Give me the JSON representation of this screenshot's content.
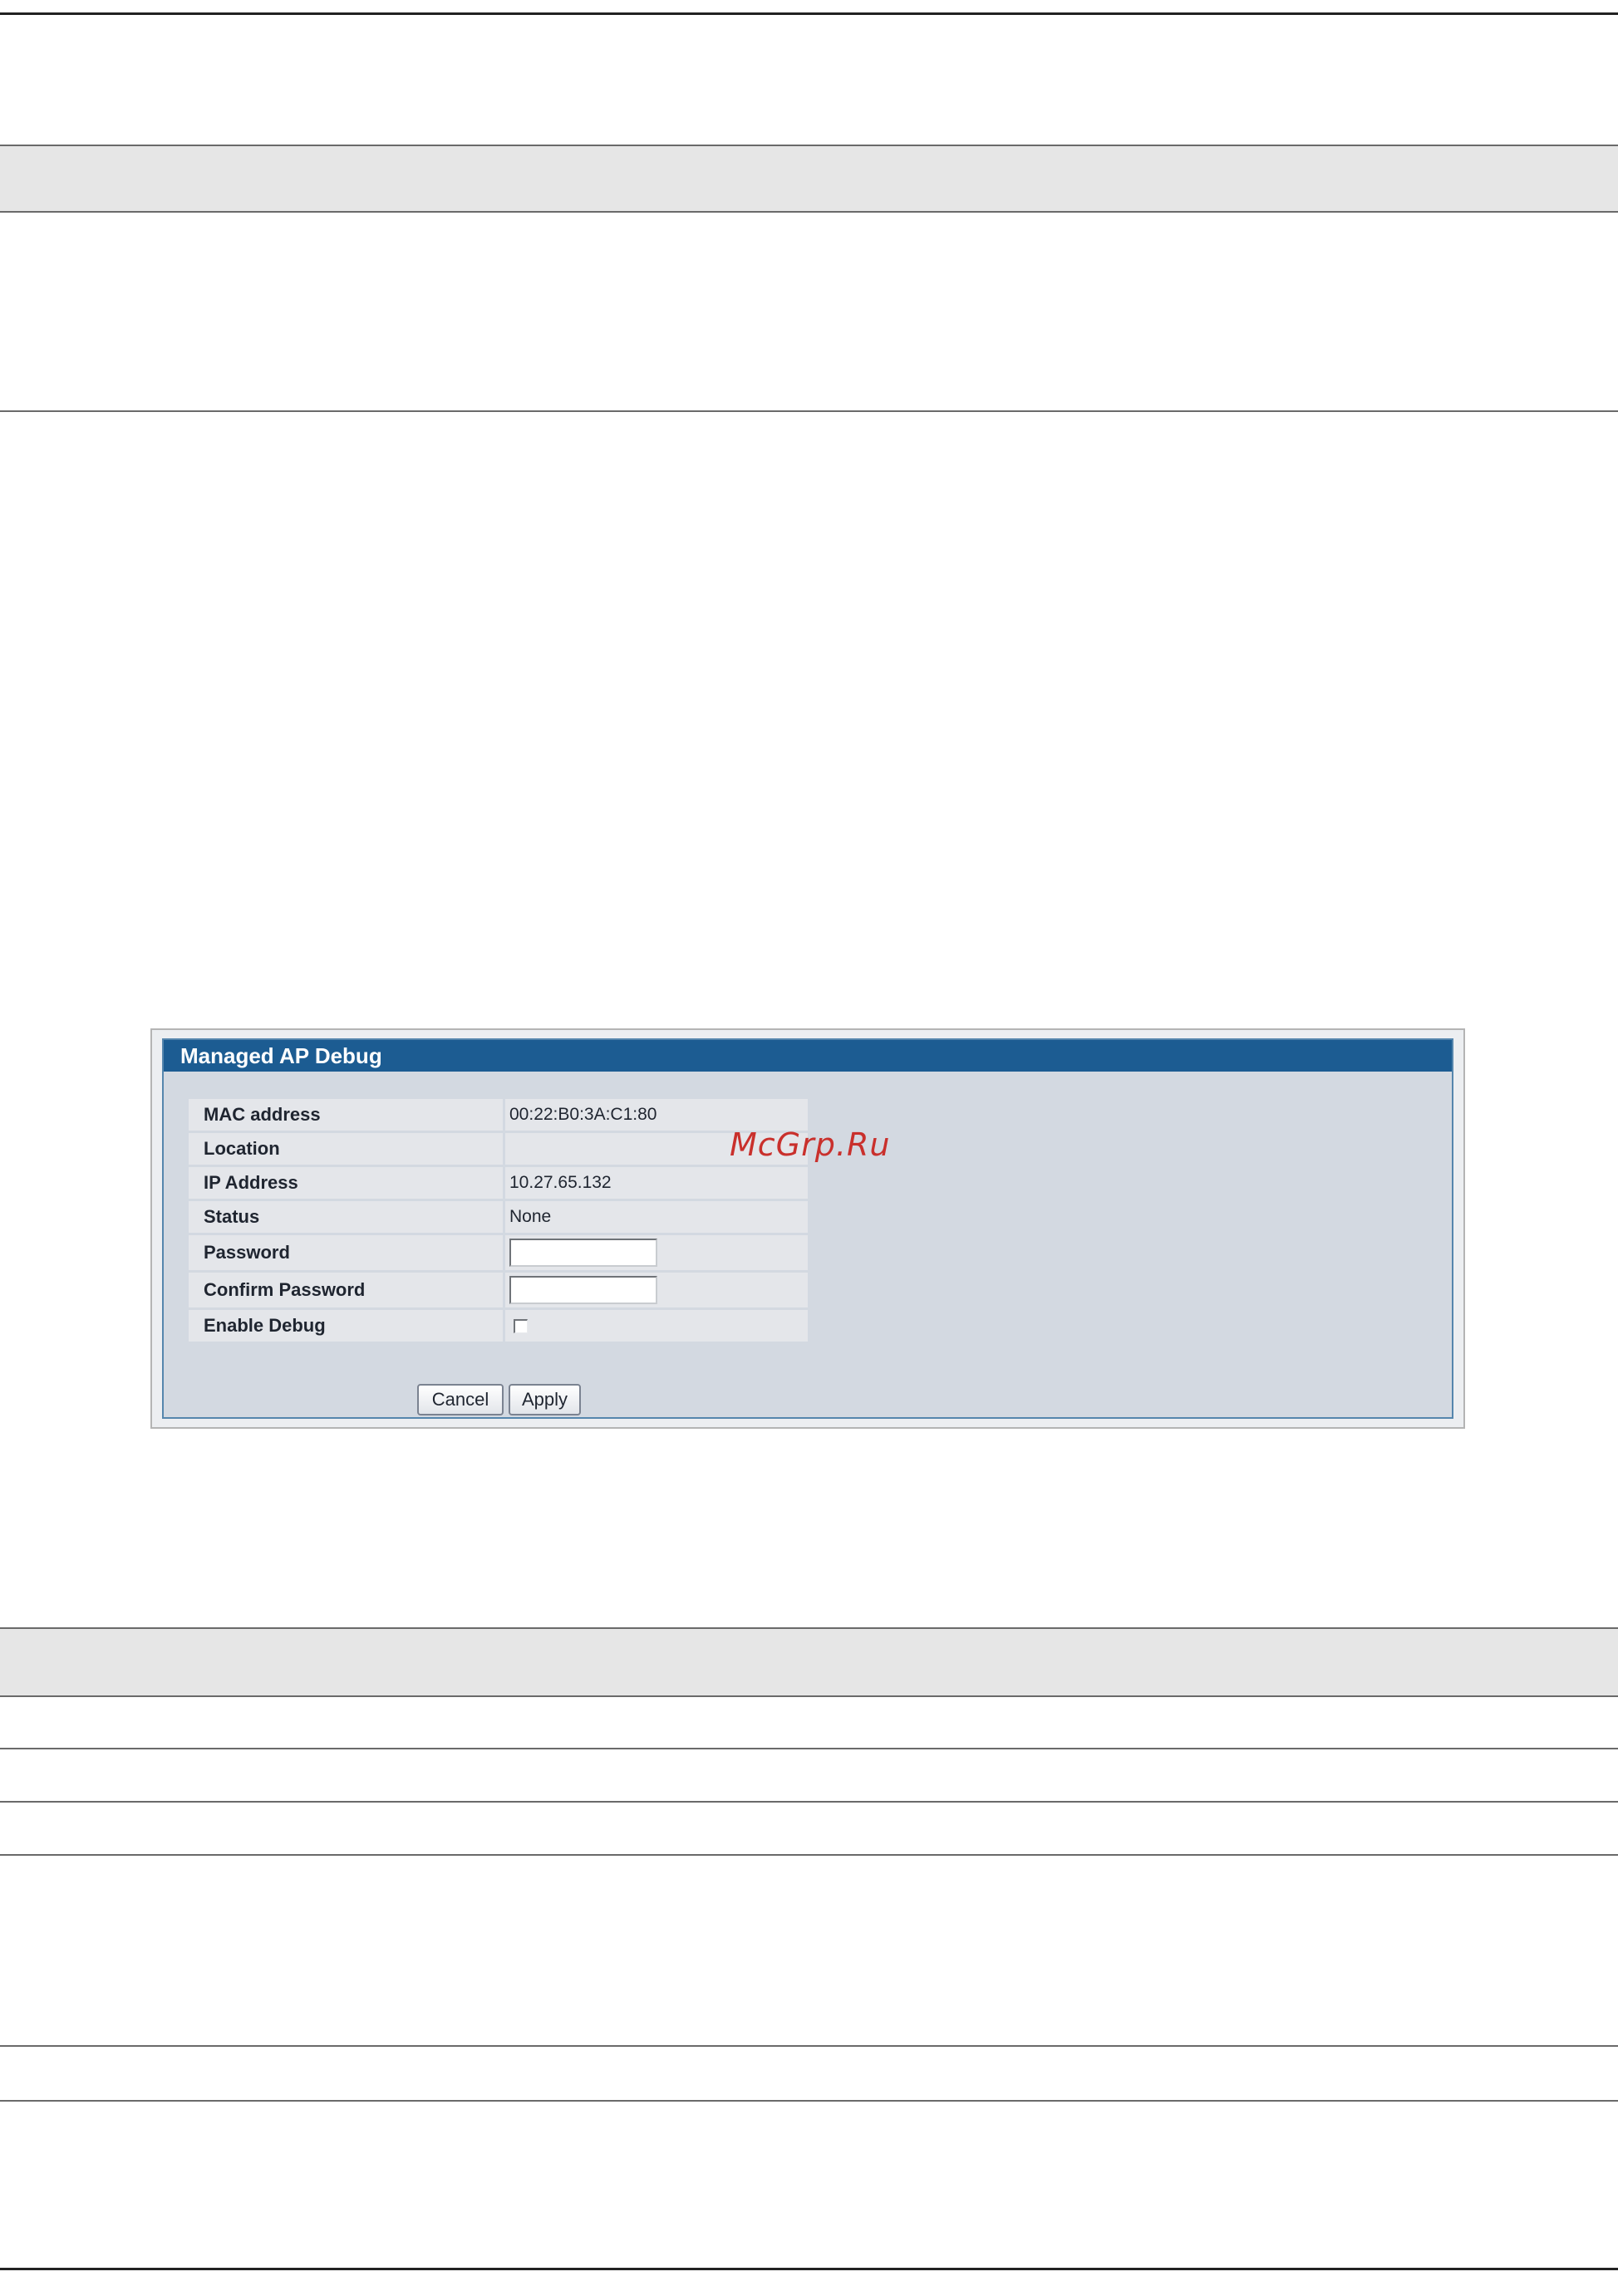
{
  "panel": {
    "title": "Managed AP Debug",
    "fields": {
      "mac_label": "MAC address",
      "mac_value": "00:22:B0:3A:C1:80",
      "location_label": "Location",
      "location_value": "",
      "ip_label": "IP Address",
      "ip_value": "10.27.65.132",
      "status_label": "Status",
      "status_value": "None",
      "password_label": "Password",
      "password_value": "",
      "confirm_label": "Confirm Password",
      "confirm_value": "",
      "debug_label": "Enable Debug",
      "debug_checked": false
    },
    "buttons": {
      "cancel": "Cancel",
      "apply": "Apply"
    }
  },
  "watermark": "McGrp.Ru",
  "colors": {
    "title_bar": "#1c5c92",
    "panel_bg": "#d3d9e1",
    "watermark": "#c9302c"
  }
}
